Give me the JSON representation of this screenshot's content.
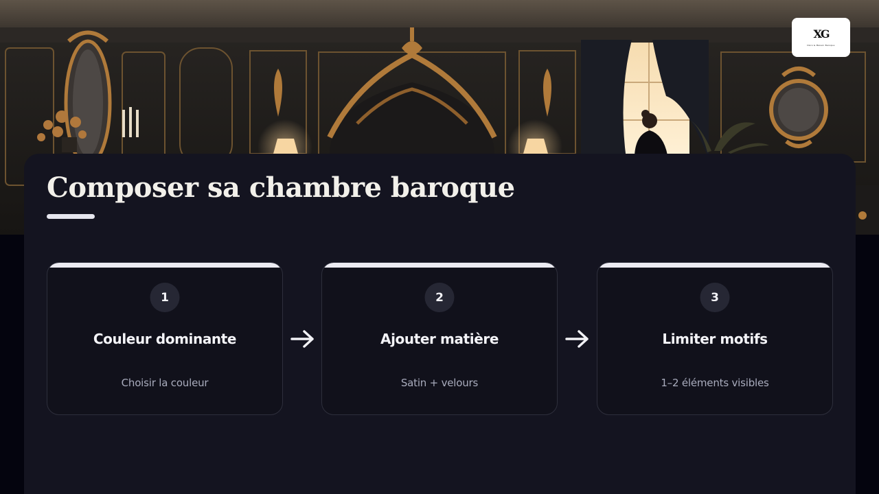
{
  "title": "Composer sa chambre baroque",
  "steps": [
    {
      "number": "1",
      "heading": "Couleur dominante",
      "description": "Choisir la couleur"
    },
    {
      "number": "2",
      "heading": "Ajouter matière",
      "description": "Satin + velours"
    },
    {
      "number": "3",
      "heading": "Limiter motifs",
      "description": "1–2 éléments visibles"
    }
  ],
  "logo": {
    "mark": "XG",
    "tagline": "Déco & Maison Baroque"
  },
  "colors": {
    "background": "#04040e",
    "panel": "#141420",
    "card_border": "#2e2f3c",
    "accent": "#ecebf2",
    "number_circle": "#262734",
    "heading_text": "#f4f4f8",
    "description_text": "#a9acbd",
    "gold": "#b07a3a"
  },
  "icons": {
    "arrow": "arrow-right-icon"
  }
}
